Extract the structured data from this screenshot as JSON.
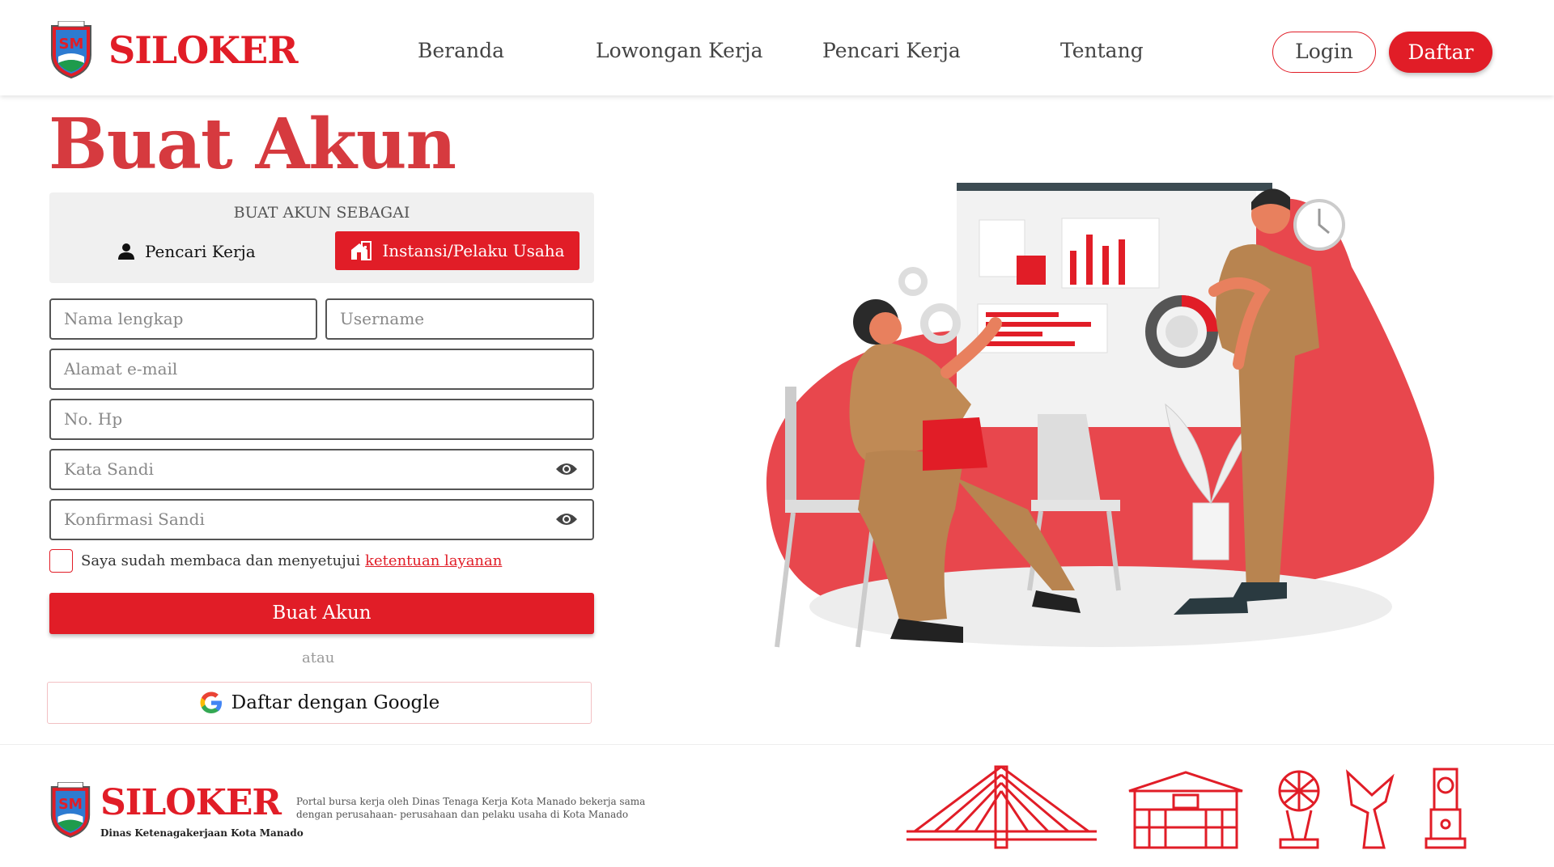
{
  "header": {
    "brand": "SILOKER",
    "nav": [
      "Beranda",
      "Lowongan Kerja",
      "Pencari Kerja",
      "Tentang"
    ],
    "login_label": "Login",
    "daftar_label": "Daftar"
  },
  "form": {
    "title": "Buat Akun",
    "type_caption": "BUAT AKUN SEBAGAI",
    "type_options": [
      "Pencari Kerja",
      "Instansi/Pelaku Usaha"
    ],
    "selected_type": "Instansi/Pelaku Usaha",
    "placeholders": {
      "full_name": "Nama lengkap",
      "username": "Username",
      "email": "Alamat e-mail",
      "phone": "No. Hp",
      "password": "Kata Sandi",
      "confirm_password": "Konfirmasi Sandi"
    },
    "terms_text": "Saya sudah membaca dan menyetujui",
    "terms_link": "ketentuan layanan",
    "submit_label": "Buat Akun",
    "or_text": "atau",
    "google_label": "Daftar dengan Google"
  },
  "footer": {
    "brand": "SILOKER",
    "subtitle": "Dinas Ketenagakerjaan Kota Manado",
    "description": "Portal bursa kerja oleh Dinas Tenaga Kerja Kota Manado bekerja sama dengan perusahaan- perusahaan dan pelaku usaha di Kota Manado"
  },
  "colors": {
    "primary": "#e11d27",
    "title": "#d63a3f",
    "illustration_blob": "#e8474d",
    "skin_tone": "#c08a55"
  },
  "icons": [
    "crest-logo",
    "user-icon",
    "building-icon",
    "eye-icon",
    "google-icon",
    "landmark-icons"
  ]
}
